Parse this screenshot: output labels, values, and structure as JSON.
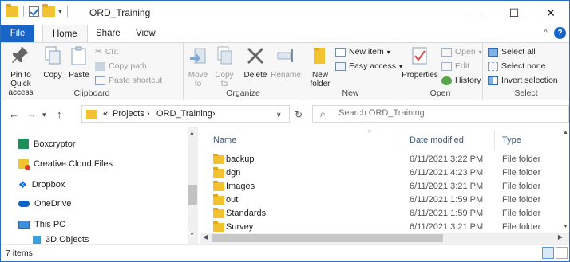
{
  "window": {
    "title": "ORD_Training",
    "minimize": "—",
    "maximize": "☐",
    "close": "✕"
  },
  "tabs": [
    "File",
    "Home",
    "Share",
    "View"
  ],
  "ribbon": {
    "clipboard": {
      "label": "Clipboard",
      "pin": "Pin to Quick access",
      "copy": "Copy",
      "paste": "Paste",
      "cut": "Cut",
      "copy_path": "Copy path",
      "paste_shortcut": "Paste shortcut"
    },
    "organize": {
      "label": "Organize",
      "move_to": "Move to",
      "copy_to": "Copy to",
      "delete": "Delete",
      "rename": "Rename"
    },
    "new": {
      "label": "New",
      "new_folder": "New folder",
      "new_item": "New item",
      "easy_access": "Easy access"
    },
    "open": {
      "label": "Open",
      "properties": "Properties",
      "open": "Open",
      "edit": "Edit",
      "history": "History"
    },
    "select": {
      "label": "Select",
      "select_all": "Select all",
      "select_none": "Select none",
      "invert": "Invert selection"
    }
  },
  "address": {
    "overflow": "«",
    "crumbs": [
      "Projects",
      "ORD_Training"
    ],
    "separator": "›"
  },
  "search": {
    "placeholder": "Search ORD_Training"
  },
  "nav_pane": [
    "Boxcryptor",
    "Creative Cloud Files",
    "Dropbox",
    "OneDrive",
    "This PC",
    "3D Objects"
  ],
  "columns": {
    "name": "Name",
    "date": "Date modified",
    "type": "Type"
  },
  "files": [
    {
      "name": "backup",
      "date": "6/11/2021 3:22 PM",
      "type": "File folder"
    },
    {
      "name": "dgn",
      "date": "6/11/2021 4:23 PM",
      "type": "File folder"
    },
    {
      "name": "Images",
      "date": "6/11/2021 3:21 PM",
      "type": "File folder"
    },
    {
      "name": "out",
      "date": "6/11/2021 1:59 PM",
      "type": "File folder"
    },
    {
      "name": "Standards",
      "date": "6/11/2021 1:59 PM",
      "type": "File folder"
    },
    {
      "name": "Survey",
      "date": "6/11/2021 3:21 PM",
      "type": "File folder"
    }
  ],
  "status": {
    "count": "7 items"
  },
  "colors": {
    "accent": "#1a64c8",
    "folder": "#f2c230"
  }
}
